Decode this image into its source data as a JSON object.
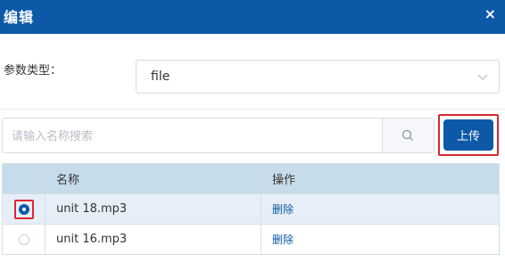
{
  "dialog": {
    "title": "编辑",
    "close_icon": "×"
  },
  "param": {
    "label": "参数类型：",
    "selected": "file"
  },
  "search": {
    "placeholder": "请输入名称搜索"
  },
  "upload": {
    "label": "上传"
  },
  "table": {
    "headers": [
      "",
      "名称",
      "操作"
    ],
    "rows": [
      {
        "selected": true,
        "name": "unit 18.mp3",
        "action": "删除"
      },
      {
        "selected": false,
        "name": "unit 16.mp3",
        "action": "删除"
      }
    ]
  },
  "colors": {
    "primary": "#0d59a8",
    "highlight": "#d9282f",
    "header_row": "#c7dcea"
  }
}
